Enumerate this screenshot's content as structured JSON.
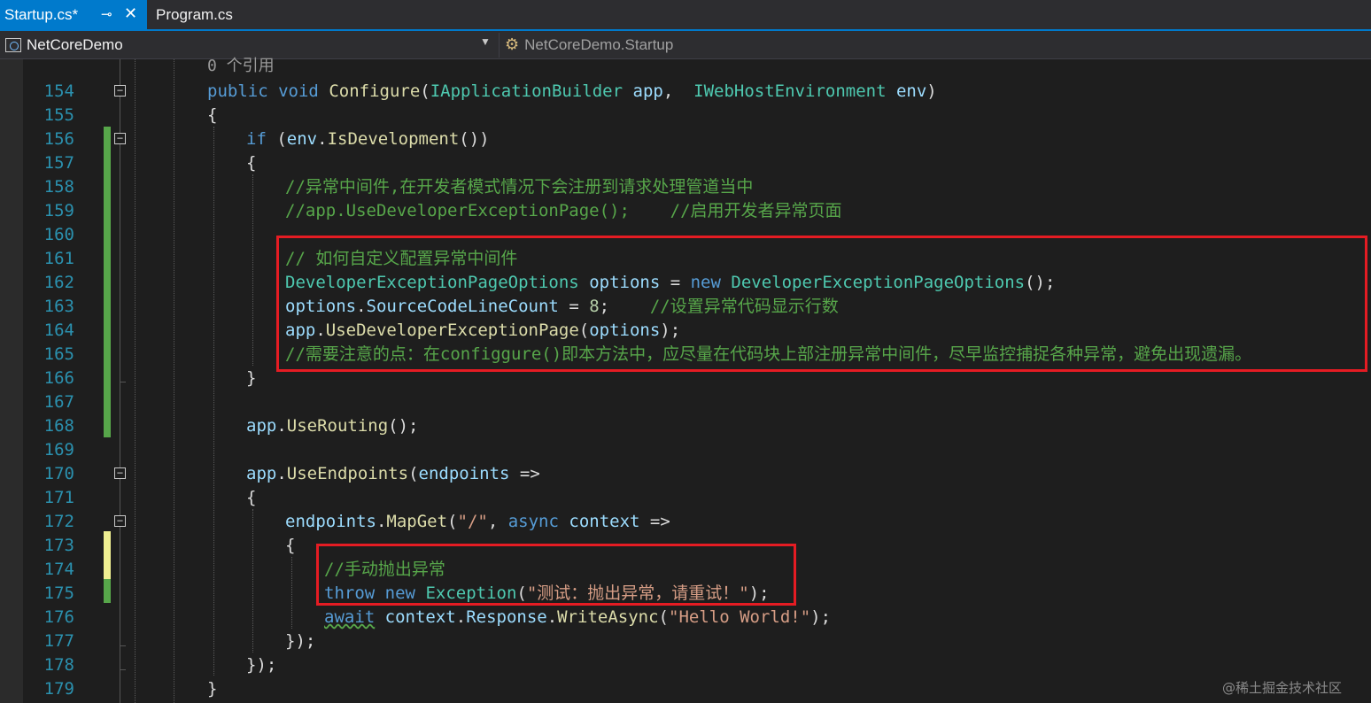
{
  "tabs": [
    {
      "label": "Startup.cs*",
      "active": true
    },
    {
      "label": "Program.cs",
      "active": false
    }
  ],
  "nav": {
    "project": "NetCoreDemo",
    "type": "NetCoreDemo.Startup"
  },
  "codelens": "0 个引用",
  "lines": [
    {
      "n": "154",
      "indent": 0,
      "tokens": [
        [
          "kw",
          "public"
        ],
        [
          "pl",
          " "
        ],
        [
          "kw",
          "void"
        ],
        [
          "pl",
          " "
        ],
        [
          "mt",
          "Configure"
        ],
        [
          "pl",
          "("
        ],
        [
          "ty",
          "IApplicationBuilder"
        ],
        [
          "pl",
          " "
        ],
        [
          "pm",
          "app"
        ],
        [
          "pl",
          ",  "
        ],
        [
          "ty",
          "IWebHostEnvironment"
        ],
        [
          "pl",
          " "
        ],
        [
          "pm",
          "env"
        ],
        [
          "pl",
          ")"
        ]
      ]
    },
    {
      "n": "155",
      "indent": 0,
      "tokens": [
        [
          "pl",
          "{"
        ]
      ]
    },
    {
      "n": "156",
      "indent": 1,
      "tokens": [
        [
          "kw",
          "if"
        ],
        [
          "pl",
          " ("
        ],
        [
          "pm",
          "env"
        ],
        [
          "pl",
          "."
        ],
        [
          "mt",
          "IsDevelopment"
        ],
        [
          "pl",
          "())"
        ]
      ]
    },
    {
      "n": "157",
      "indent": 1,
      "tokens": [
        [
          "pl",
          "{"
        ]
      ]
    },
    {
      "n": "158",
      "indent": 2,
      "tokens": [
        [
          "cm",
          "//异常中间件,在开发者模式情况下会注册到请求处理管道当中"
        ]
      ]
    },
    {
      "n": "159",
      "indent": 2,
      "tokens": [
        [
          "cm",
          "//app.UseDeveloperExceptionPage();    //启用开发者异常页面"
        ]
      ]
    },
    {
      "n": "160",
      "indent": 2,
      "tokens": []
    },
    {
      "n": "161",
      "indent": 2,
      "tokens": [
        [
          "cm",
          "// 如何自定义配置异常中间件"
        ]
      ]
    },
    {
      "n": "162",
      "indent": 2,
      "tokens": [
        [
          "ty",
          "DeveloperExceptionPageOptions"
        ],
        [
          "pl",
          " "
        ],
        [
          "pm",
          "options"
        ],
        [
          "pl",
          " = "
        ],
        [
          "kw",
          "new"
        ],
        [
          "pl",
          " "
        ],
        [
          "ty",
          "DeveloperExceptionPageOptions"
        ],
        [
          "pl",
          "();"
        ]
      ]
    },
    {
      "n": "163",
      "indent": 2,
      "tokens": [
        [
          "pm",
          "options"
        ],
        [
          "pl",
          "."
        ],
        [
          "pm",
          "SourceCodeLineCount"
        ],
        [
          "pl",
          " = "
        ],
        [
          "nu",
          "8"
        ],
        [
          "pl",
          ";    "
        ],
        [
          "cm",
          "//设置异常代码显示行数"
        ]
      ]
    },
    {
      "n": "164",
      "indent": 2,
      "tokens": [
        [
          "pm",
          "app"
        ],
        [
          "pl",
          "."
        ],
        [
          "mt",
          "UseDeveloperExceptionPage"
        ],
        [
          "pl",
          "("
        ],
        [
          "pm",
          "options"
        ],
        [
          "pl",
          ");"
        ]
      ]
    },
    {
      "n": "165",
      "indent": 2,
      "tokens": [
        [
          "cm",
          "//需要注意的点：在configgure()即本方法中，应尽量在代码块上部注册异常中间件，尽早监控捕捉各种异常，避免出现遗漏。"
        ]
      ]
    },
    {
      "n": "166",
      "indent": 1,
      "tokens": [
        [
          "pl",
          "}"
        ]
      ]
    },
    {
      "n": "167",
      "indent": 1,
      "tokens": []
    },
    {
      "n": "168",
      "indent": 1,
      "tokens": [
        [
          "pm",
          "app"
        ],
        [
          "pl",
          "."
        ],
        [
          "mt",
          "UseRouting"
        ],
        [
          "pl",
          "();"
        ]
      ]
    },
    {
      "n": "169",
      "indent": 1,
      "tokens": []
    },
    {
      "n": "170",
      "indent": 1,
      "tokens": [
        [
          "pm",
          "app"
        ],
        [
          "pl",
          "."
        ],
        [
          "mt",
          "UseEndpoints"
        ],
        [
          "pl",
          "("
        ],
        [
          "pm",
          "endpoints"
        ],
        [
          "pl",
          " =>"
        ]
      ]
    },
    {
      "n": "171",
      "indent": 1,
      "tokens": [
        [
          "pl",
          "{"
        ]
      ]
    },
    {
      "n": "172",
      "indent": 2,
      "tokens": [
        [
          "pm",
          "endpoints"
        ],
        [
          "pl",
          "."
        ],
        [
          "mt",
          "MapGet"
        ],
        [
          "pl",
          "("
        ],
        [
          "st",
          "\"/\""
        ],
        [
          "pl",
          ", "
        ],
        [
          "kw",
          "async"
        ],
        [
          "pl",
          " "
        ],
        [
          "pm",
          "context"
        ],
        [
          "pl",
          " =>"
        ]
      ]
    },
    {
      "n": "173",
      "indent": 2,
      "tokens": [
        [
          "pl",
          "{"
        ]
      ]
    },
    {
      "n": "174",
      "indent": 3,
      "tokens": [
        [
          "cm",
          "//手动抛出异常"
        ]
      ]
    },
    {
      "n": "175",
      "indent": 3,
      "tokens": [
        [
          "kw",
          "throw"
        ],
        [
          "pl",
          " "
        ],
        [
          "kw",
          "new"
        ],
        [
          "pl",
          " "
        ],
        [
          "ty",
          "Exception"
        ],
        [
          "pl",
          "("
        ],
        [
          "st",
          "\"测试：抛出异常，请重试！\""
        ],
        [
          "pl",
          ");"
        ]
      ]
    },
    {
      "n": "176",
      "indent": 3,
      "tokens": [
        [
          "kw sq",
          "await"
        ],
        [
          "pl",
          " "
        ],
        [
          "pm",
          "context"
        ],
        [
          "pl",
          "."
        ],
        [
          "pm",
          "Response"
        ],
        [
          "pl",
          "."
        ],
        [
          "mt",
          "WriteAsync"
        ],
        [
          "pl",
          "("
        ],
        [
          "st",
          "\"Hello World!\""
        ],
        [
          "pl",
          ");"
        ]
      ]
    },
    {
      "n": "177",
      "indent": 2,
      "tokens": [
        [
          "pl",
          "});"
        ]
      ]
    },
    {
      "n": "178",
      "indent": 1,
      "tokens": [
        [
          "pl",
          "});"
        ]
      ]
    },
    {
      "n": "179",
      "indent": 0,
      "tokens": [
        [
          "pl",
          "}"
        ]
      ]
    }
  ],
  "watermark": "@稀土掘金技术社区",
  "colors": {
    "background": "#1e1e1e",
    "keyword": "#569cd6",
    "type": "#4ec9b0",
    "method": "#dcdcaa",
    "comment": "#57a64a",
    "string": "#d69d85",
    "line_number": "#2b91af",
    "highlight_box": "#e51c23",
    "active_tab": "#007acc"
  }
}
